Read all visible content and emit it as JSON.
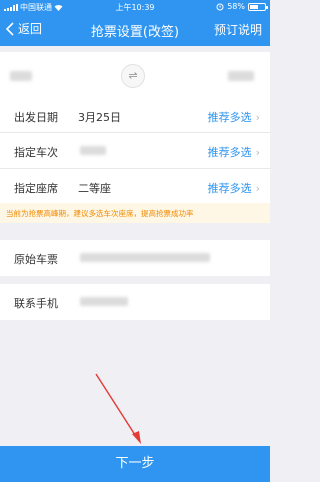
{
  "status_bar": {
    "carrier": "中国联通",
    "time": "上午10:39",
    "battery": "58%",
    "battery_level": 0.58
  },
  "nav": {
    "back_label": "返回",
    "title": "抢票设置(改签)",
    "right_label": "预订说明"
  },
  "rows": {
    "departure_date": {
      "label": "出发日期",
      "value": "3月25日",
      "action": "推荐多选"
    },
    "train_no": {
      "label": "指定车次",
      "value": "",
      "action": "推荐多选"
    },
    "seat": {
      "label": "指定座席",
      "value": "二等座",
      "action": "推荐多选"
    },
    "original_ticket": {
      "label": "原始车票",
      "value": ""
    },
    "contact_phone": {
      "label": "联系手机",
      "value": ""
    }
  },
  "notice": "当前为抢票高峰期，建议多选车次座席，提高抢票成功率",
  "bottom_button": "下一步",
  "colors": {
    "primary": "#2f95f1",
    "notice_text": "#f08a00",
    "arrow": "#e53935"
  }
}
